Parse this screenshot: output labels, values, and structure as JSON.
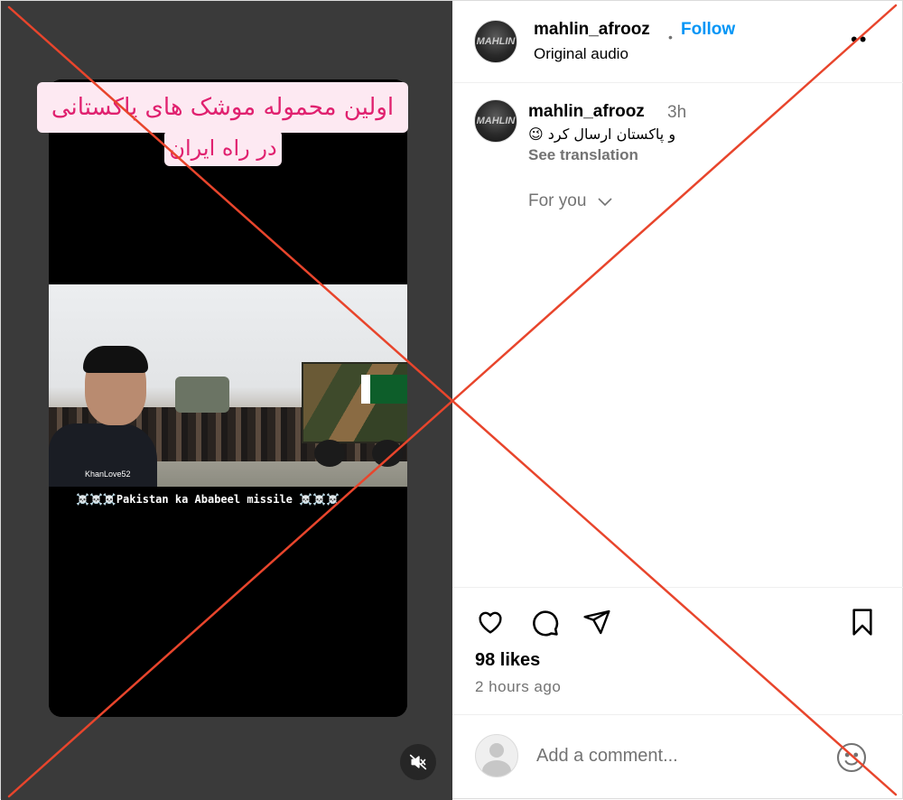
{
  "media": {
    "caption_line1": "اولین محموله موشک های پاکستانی",
    "caption_line2": "در راه ایران",
    "video_watermark": "KhanLove52",
    "video_bar_text": "☠️☠️☠️Pakistan ka Ababeel missile ☠️☠️☠️",
    "mute_icon": "speaker-muted-icon"
  },
  "header": {
    "username": "mahlin_afrooz",
    "avatar_text": "MAHLIN",
    "separator": "•",
    "follow_label": "Follow",
    "audio_label": "Original audio",
    "more_label": "••"
  },
  "post": {
    "username": "mahlin_afrooz",
    "time": "3h",
    "caption": "و پاکستان ارسال کرد 😉",
    "see_translation": "See translation",
    "for_you": "For you"
  },
  "actions": {
    "like_icon": "heart-icon",
    "comment_icon": "comment-icon",
    "share_icon": "share-icon",
    "save_icon": "bookmark-icon",
    "likes": "98 likes",
    "timestamp": "2 hours ago"
  },
  "comment_box": {
    "placeholder": "Add a comment...",
    "emoji_icon": "emoji-icon"
  },
  "overlay": {
    "cross_color": "#e8452c"
  },
  "colors": {
    "accent": "#0095f6",
    "secondary_text": "#737373",
    "media_bg": "#3a3a3a",
    "caption_pink": "#e0216f"
  }
}
